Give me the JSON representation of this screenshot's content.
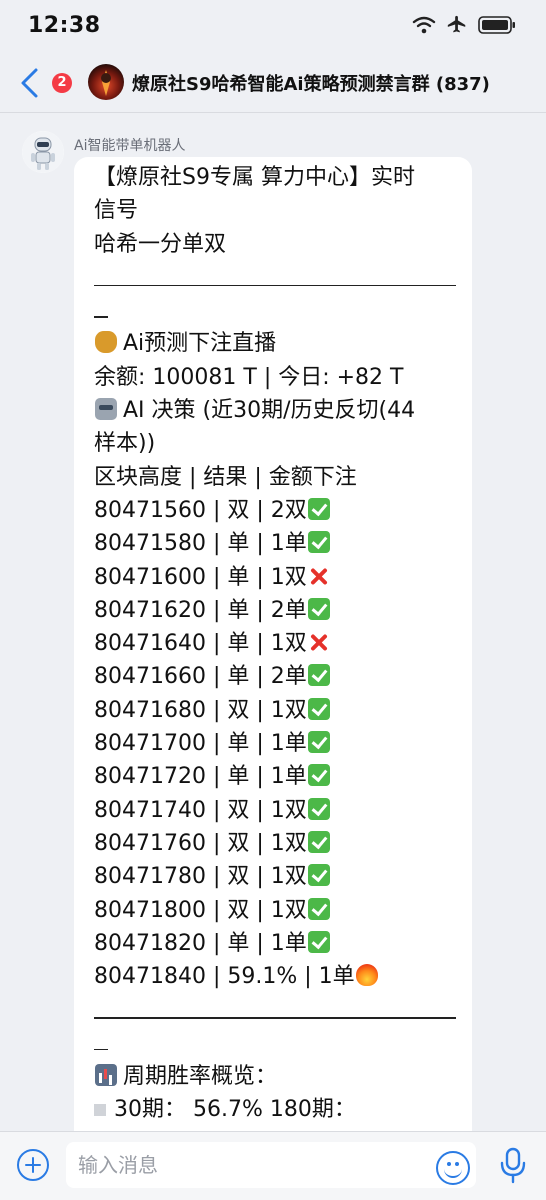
{
  "status_bar": {
    "time": "12:38"
  },
  "header": {
    "unread_count": "2",
    "title": "燎原社S9哈希智能Ai策略预测禁言群 (837)"
  },
  "message": {
    "sender": "Ai智能带单机器人",
    "heading_line1": "【燎原社S9专属 算力中心】实时",
    "heading_line2": "信号",
    "game": "哈希一分单双",
    "live_title": "Ai预测下注直播",
    "balance": "余额: 100081 T | 今日: +82 T",
    "decision_line1": "AI 决策 (近30期/历史反切(44",
    "decision_line2": "样本))",
    "table_header": "区块高度 |  结果 |  金额下注",
    "rows": [
      {
        "text": "80471560 |  双 |  2双",
        "mark": "ok"
      },
      {
        "text": "80471580 |  单 |  1单",
        "mark": "ok"
      },
      {
        "text": "80471600 |  单 |  1双",
        "mark": "bad"
      },
      {
        "text": "80471620 |  单 |  2单",
        "mark": "ok"
      },
      {
        "text": "80471640 |  单 |  1双",
        "mark": "bad"
      },
      {
        "text": "80471660 |  单 |  2单",
        "mark": "ok"
      },
      {
        "text": "80471680 |  双 |  1双",
        "mark": "ok"
      },
      {
        "text": "80471700 |  单 |  1单",
        "mark": "ok"
      },
      {
        "text": "80471720 |  单 |  1单",
        "mark": "ok"
      },
      {
        "text": "80471740 |  双 |  1双",
        "mark": "ok"
      },
      {
        "text": "80471760 |  双 |  1双",
        "mark": "ok"
      },
      {
        "text": "80471780 |  双 |  1双",
        "mark": "ok"
      },
      {
        "text": "80471800 |  双 |  1双",
        "mark": "ok"
      },
      {
        "text": "80471820 |  单 |  1单",
        "mark": "ok"
      }
    ],
    "last_row": "80471840 |  59.1% |  1单",
    "winrate_title": "周期胜率概览：",
    "winrate_partial": "30期：  56.7%     180期："
  },
  "input": {
    "placeholder": "输入消息"
  },
  "colors": {
    "accent": "#2a7be4",
    "badge": "#f43b45",
    "ok": "#4cb848",
    "bad": "#e5312a"
  }
}
